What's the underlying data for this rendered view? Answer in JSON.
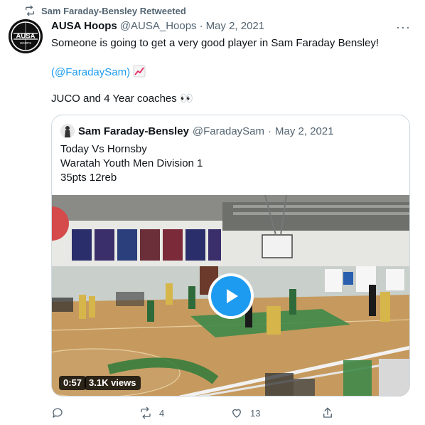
{
  "retweet": {
    "icon": "retweet-icon",
    "label": "Sam Faraday-Bensley Retweeted"
  },
  "tweet": {
    "author_name": "AUSA Hoops",
    "author_handle": "@AUSA_Hoops",
    "separator": "·",
    "date": "May 2, 2021",
    "more": "···",
    "avatar_logo_text": "AUSA",
    "avatar_logo_sub": "HOOPS",
    "line1": "Someone is going to get a very good player in Sam Faraday Bensley!",
    "mention": "(@FaradaySam)",
    "line3": "JUCO and 4 Year coaches 👀"
  },
  "quote": {
    "author_name": "Sam Faraday-Bensley",
    "author_handle": "@FaradaySam",
    "separator": "·",
    "date": "May 2, 2021",
    "lines": [
      "Today Vs Hornsby",
      "Waratah Youth Men Division 1",
      "35pts 12reb"
    ],
    "video": {
      "duration": "0:57",
      "views": "3.1K views",
      "play_icon": "play-icon"
    }
  },
  "actions": {
    "reply_count": "",
    "retweet_count": "4",
    "like_count": "13",
    "share_count": ""
  },
  "colors": {
    "accent": "#1d9bf0",
    "muted": "#536471",
    "text": "#0f1419",
    "border": "#cfd9de"
  }
}
